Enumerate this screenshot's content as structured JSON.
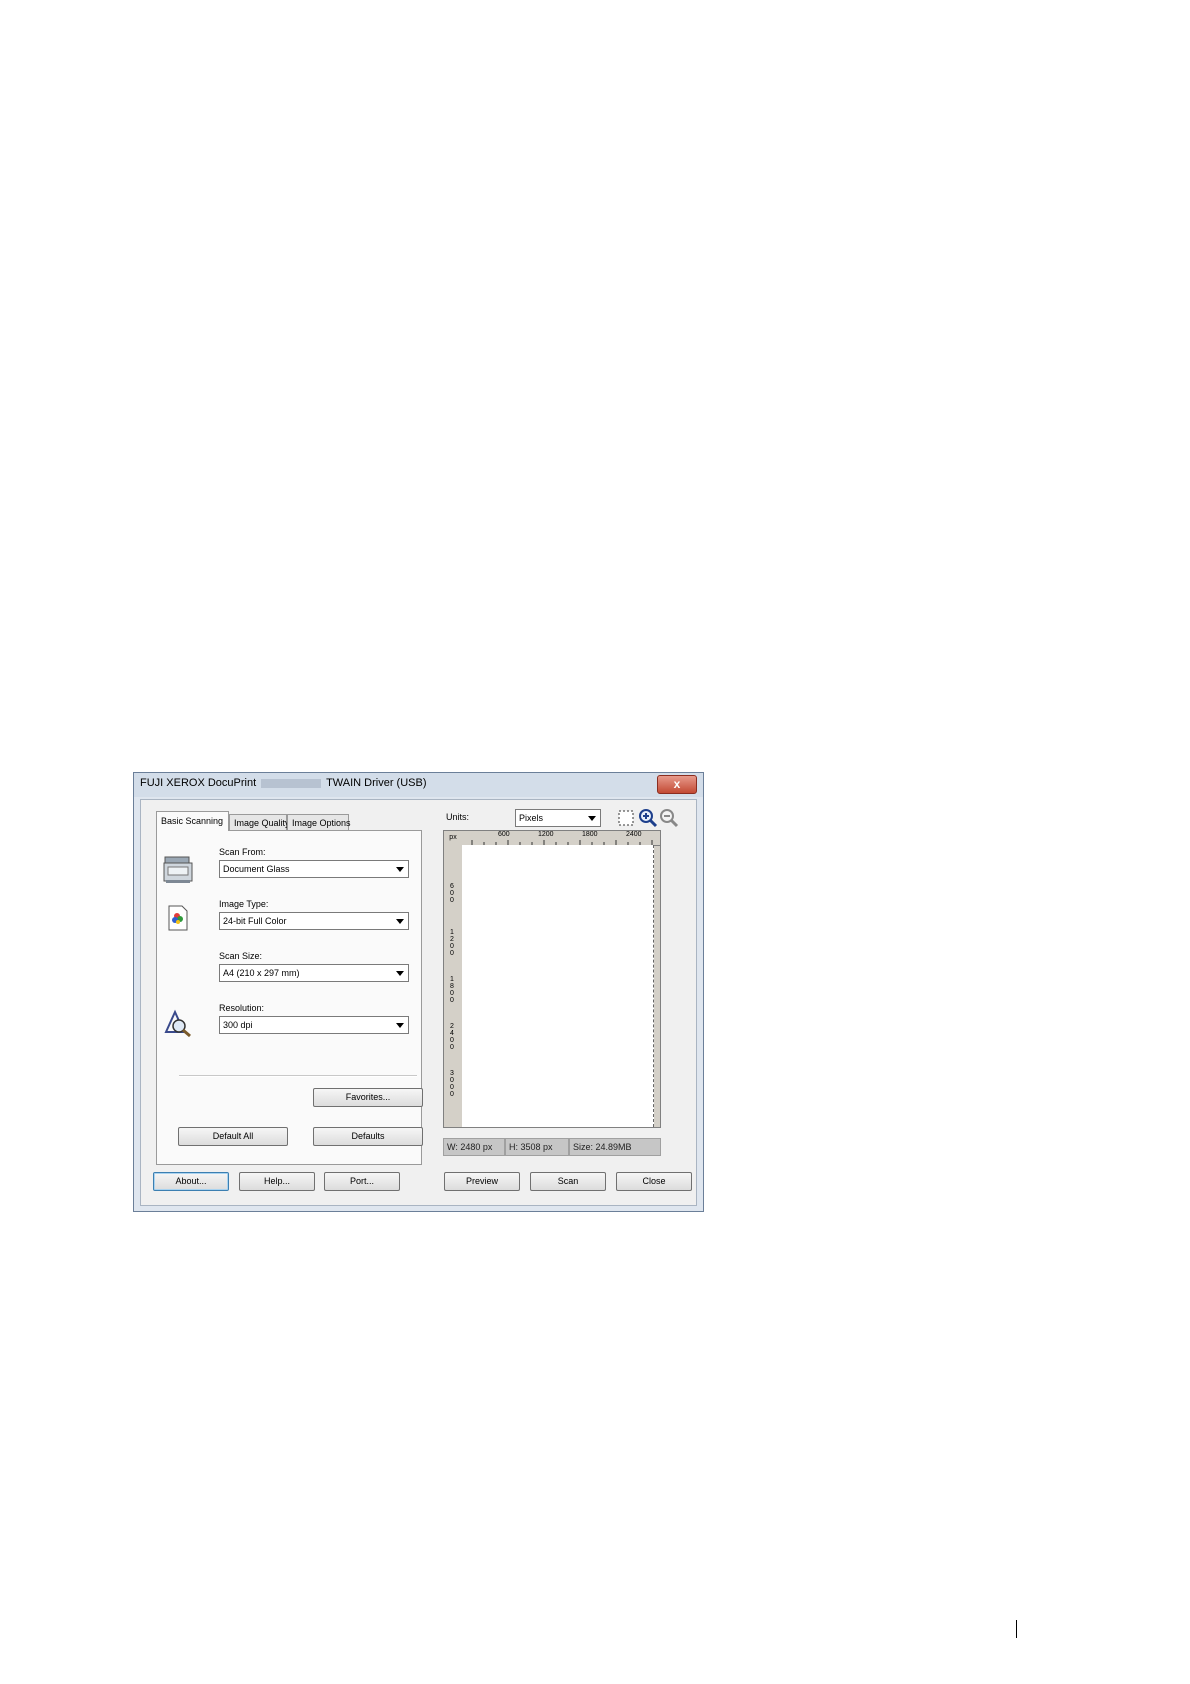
{
  "window": {
    "title_prefix": "FUJI XEROX DocuPrint",
    "title_suffix": "TWAIN Driver (USB)",
    "close_glyph": "x"
  },
  "tabs": [
    {
      "label": "Basic Scanning",
      "active": true
    },
    {
      "label": "Image Quality",
      "active": false
    },
    {
      "label": "Image Options",
      "active": false
    }
  ],
  "basic": {
    "scan_from": {
      "label": "Scan From:",
      "value": "Document Glass"
    },
    "image_type": {
      "label": "Image Type:",
      "value": "24-bit Full Color"
    },
    "scan_size": {
      "label": "Scan Size:",
      "value": "A4 (210 x 297 mm)"
    },
    "resolution": {
      "label": "Resolution:",
      "value": "300 dpi"
    },
    "favorites_label": "Favorites...",
    "default_all_label": "Default All",
    "defaults_label": "Defaults"
  },
  "preview": {
    "units_label": "Units:",
    "units_value": "Pixels",
    "ruler_corner": "px",
    "ruler_top": [
      "600",
      "1200",
      "1800",
      "2400"
    ],
    "ruler_left": [
      "600",
      "1200",
      "1800",
      "2400",
      "3000"
    ],
    "width_text": "W: 2480 px",
    "height_text": "H: 3508 px",
    "size_text": "Size: 24.89MB"
  },
  "buttons": {
    "about": "About...",
    "help": "Help...",
    "port": "Port...",
    "preview": "Preview",
    "scan": "Scan",
    "close": "Close"
  }
}
